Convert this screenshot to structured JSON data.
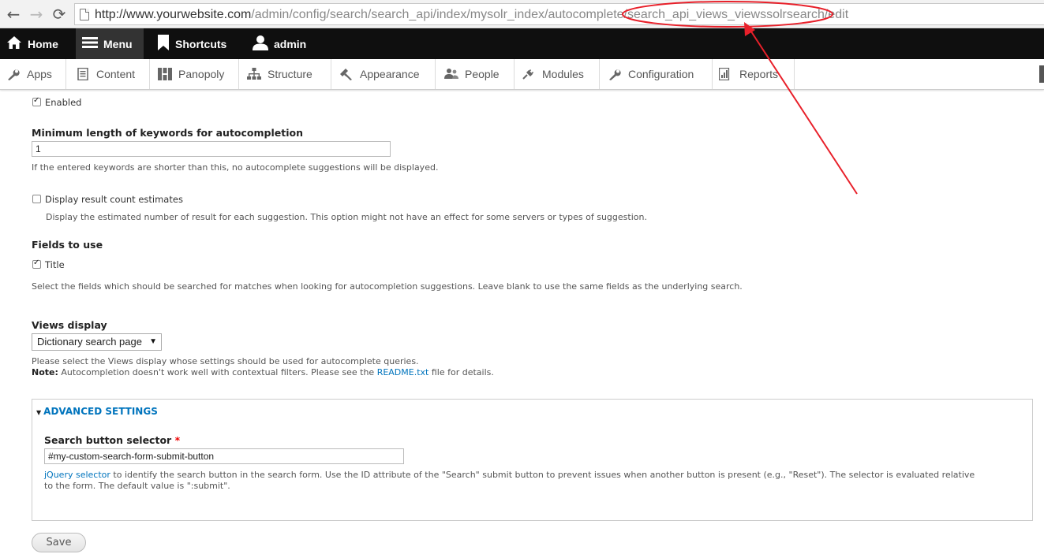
{
  "browser": {
    "back_icon": "back-arrow-icon",
    "forward_icon": "forward-arrow-icon",
    "reload_icon": "reload-icon",
    "url_host": "http://www.yourwebsite.com",
    "url_path": "/admin/config/search/search_api/index/mysolr_index/autocomplete/search_api_views_viewssolrsearch/edit"
  },
  "toolbar": {
    "home": "Home",
    "menu": "Menu",
    "shortcuts": "Shortcuts",
    "user": "admin"
  },
  "tray": {
    "items": [
      {
        "label": "Apps",
        "icon": "wrench-icon"
      },
      {
        "label": "Content",
        "icon": "document-icon"
      },
      {
        "label": "Panopoly",
        "icon": "panels-icon"
      },
      {
        "label": "Structure",
        "icon": "sitemap-icon"
      },
      {
        "label": "Appearance",
        "icon": "paintbrush-icon"
      },
      {
        "label": "People",
        "icon": "people-icon"
      },
      {
        "label": "Modules",
        "icon": "plug-icon"
      },
      {
        "label": "Configuration",
        "icon": "wrench-icon"
      },
      {
        "label": "Reports",
        "icon": "chart-icon"
      }
    ]
  },
  "form": {
    "enabled_label": "Enabled",
    "enabled_checked": true,
    "min_length_label": "Minimum length of keywords for autocompletion",
    "min_length_value": "1",
    "min_length_desc": "If the entered keywords are shorter than this, no autocomplete suggestions will be displayed.",
    "count_label": "Display result count estimates",
    "count_checked": false,
    "count_desc": "Display the estimated number of result for each suggestion. This option might not have an effect for some servers or types of suggestion.",
    "fields_label": "Fields to use",
    "fields_title_label": "Title",
    "fields_title_checked": true,
    "fields_desc": "Select the fields which should be searched for matches when looking for autocompletion suggestions. Leave blank to use the same fields as the underlying search.",
    "views_display_label": "Views display",
    "views_display_value": "Dictionary search page",
    "views_desc": "Please select the Views display whose settings should be used for autocomplete queries.",
    "note_prefix": "Note:",
    "note_text_before": " Autocompletion doesn't work well with contextual filters. Please see the ",
    "note_link": "README.txt",
    "note_text_after": " file for details.",
    "advanced_legend": "ADVANCED SETTINGS",
    "button_selector_label": "Search button selector",
    "required_mark": "*",
    "button_selector_value": "#my-custom-search-form-submit-button",
    "selector_link": "jQuery selector",
    "selector_desc_line1": " to identify the search button in the search form. Use the ID attribute of the \"Search\" submit button to prevent issues when another button is present (e.g., \"Reset\"). The selector is evaluated relative",
    "selector_desc_line2": "to the form. The default value is \":submit\".",
    "save_label": "Save"
  },
  "colors": {
    "toolbar_bg": "#0f0f0f",
    "link": "#0074bd",
    "annotation": "#e8202a"
  }
}
